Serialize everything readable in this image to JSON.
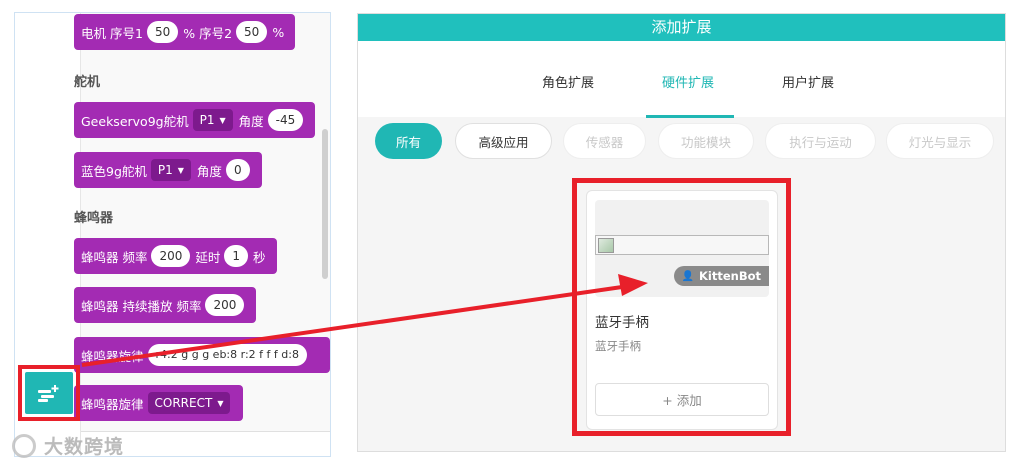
{
  "colors": {
    "accent": "#20b7b4",
    "header": "#20c0bd",
    "block": "#a32bb3",
    "dropdown": "#7d1a8d",
    "highlight": "#e8202a"
  },
  "left": {
    "blocks": {
      "motor": {
        "label1": "电机 序号1",
        "value1": "50",
        "label2": "% 序号2",
        "value2": "50",
        "suffix": "%"
      },
      "servo_category": "舵机",
      "geek_servo": {
        "label": "Geekservo9g舵机",
        "port": "P1",
        "angle_label": "角度",
        "angle": "-45"
      },
      "blue_servo": {
        "label": "蓝色9g舵机",
        "port": "P1",
        "angle_label": "角度",
        "angle": "0"
      },
      "buzzer_category": "蜂鸣器",
      "buzzer_freq": {
        "label": "蜂鸣器 频率",
        "freq": "200",
        "delay_label": "延时",
        "delay": "1",
        "unit": "秒"
      },
      "buzzer_continuous": {
        "label": "蜂鸣器 持续播放 频率",
        "freq": "200"
      },
      "buzzer_melody": {
        "label": "蜂鸣器旋律",
        "notes": "r4:2 g g g eb:8 r:2 f f f d:8"
      },
      "buzzer_melody2": {
        "label": "蜂鸣器旋律",
        "melody": "CORRECT"
      }
    },
    "extension_button_icon": "add-extension-icon"
  },
  "watermark": "大数跨境",
  "dialog": {
    "title": "添加扩展",
    "tabs": [
      {
        "label": "角色扩展"
      },
      {
        "label": "硬件扩展"
      },
      {
        "label": "用户扩展"
      }
    ],
    "filters": [
      {
        "label": "所有"
      },
      {
        "label": "高级应用"
      },
      {
        "label": "传感器"
      },
      {
        "label": "功能模块"
      },
      {
        "label": "执行与运动"
      },
      {
        "label": "灯光与显示"
      }
    ],
    "card": {
      "author": "KittenBot",
      "title": "蓝牙手柄",
      "description": "蓝牙手柄",
      "add_label": "+ 添加"
    }
  }
}
